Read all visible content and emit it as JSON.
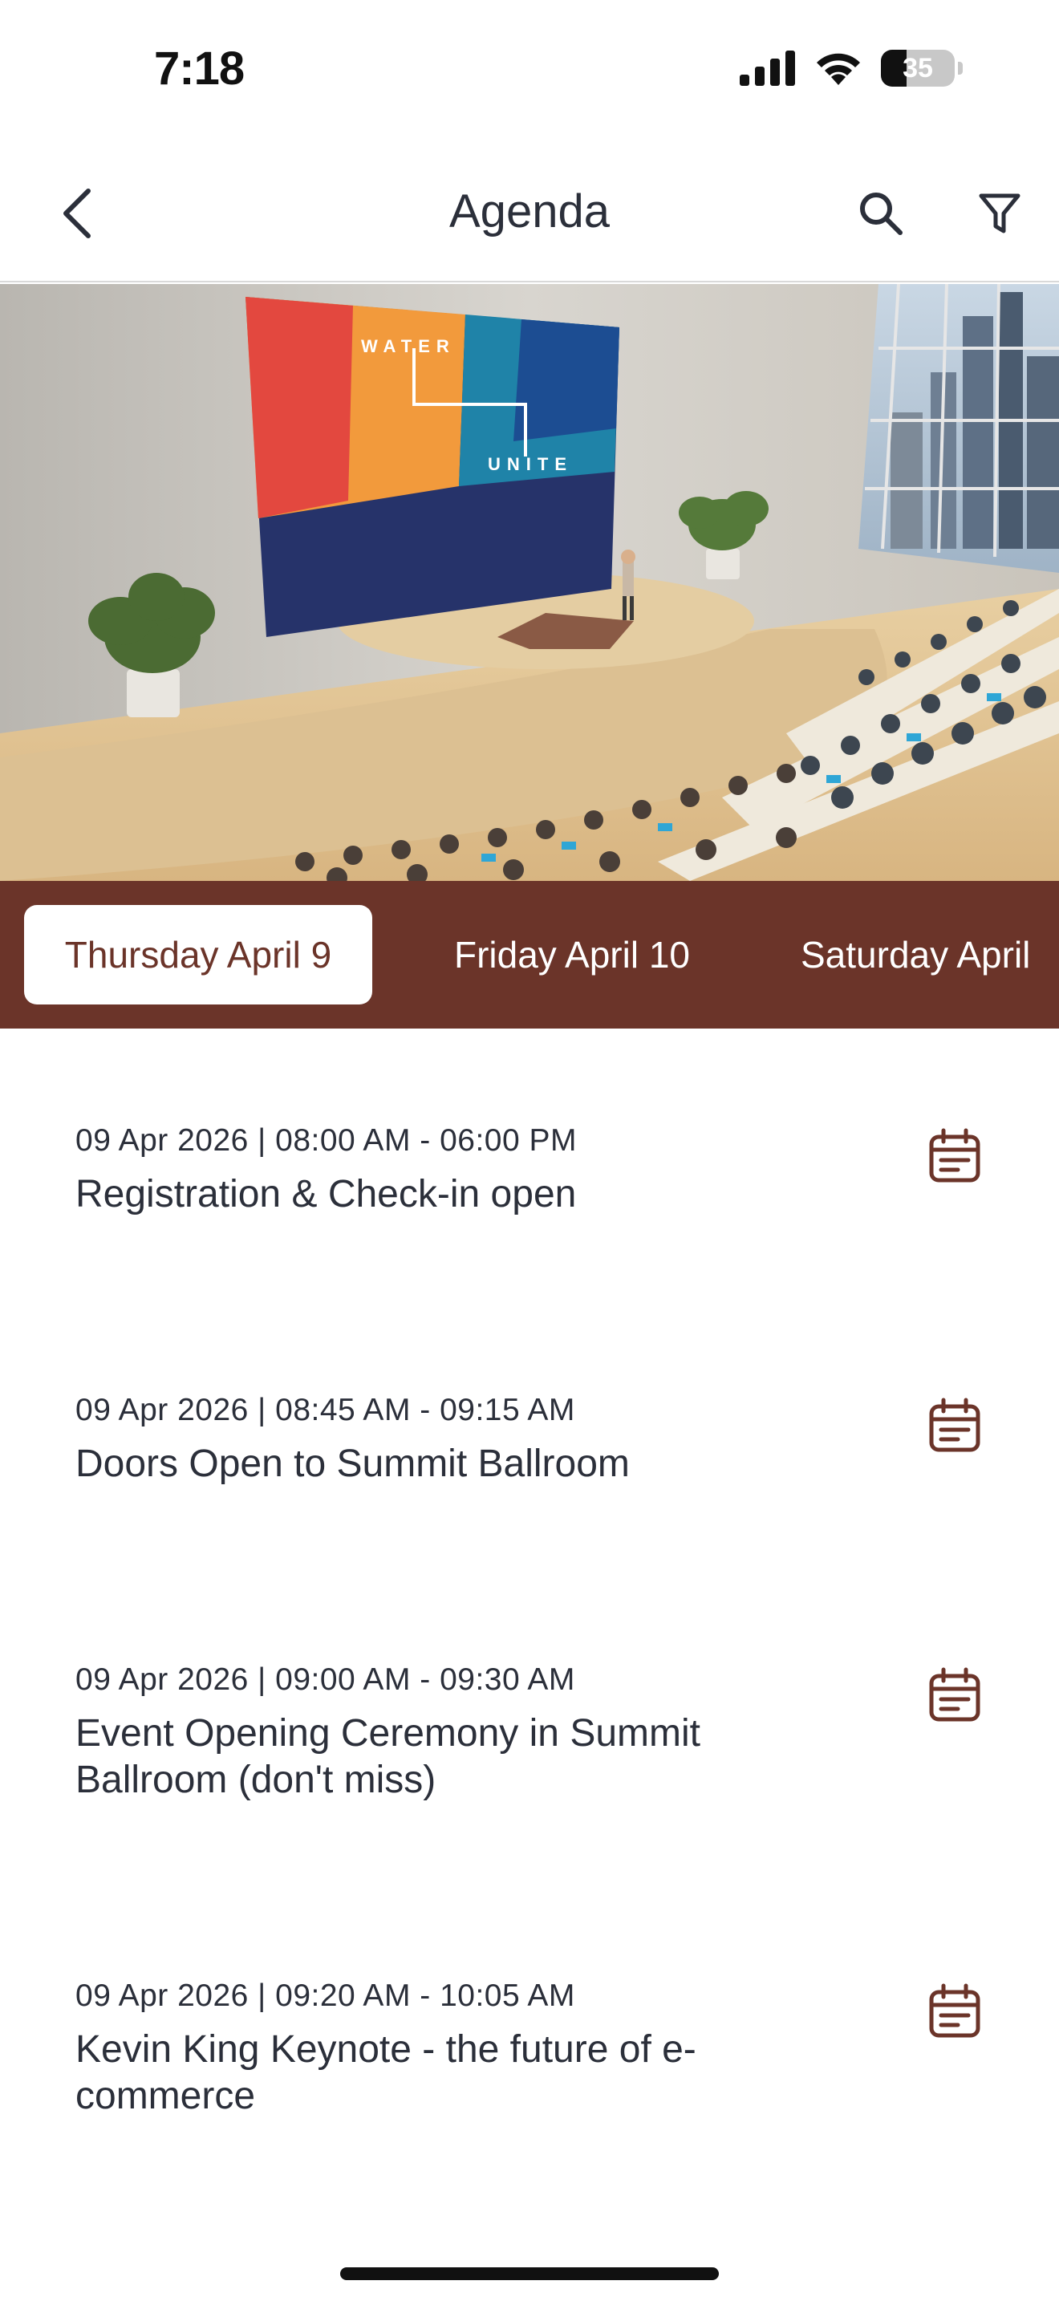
{
  "status_bar": {
    "time": "7:18",
    "battery_level": "35",
    "icons": [
      "cellular-signal-icon",
      "wifi-icon",
      "battery-icon"
    ]
  },
  "header": {
    "title": "Agenda",
    "icons": [
      "chevron-left-icon",
      "search-icon",
      "filter-icon"
    ]
  },
  "banner": {
    "screen_words": [
      "WATER",
      "UNITE"
    ]
  },
  "colors": {
    "accent": "#6b3429",
    "text": "#2b2f3a",
    "tab_active_bg": "#ffffff"
  },
  "day_tabs": [
    {
      "label": "Thursday April 9",
      "selected": true
    },
    {
      "label": "Friday April 10",
      "selected": false
    },
    {
      "label": "Saturday April",
      "selected": false
    }
  ],
  "agenda": [
    {
      "time": "09 Apr 2026 | 08:00 AM - 06:00 PM",
      "title": "Registration & Check-in open"
    },
    {
      "time": "09 Apr 2026 | 08:45 AM - 09:15 AM",
      "title": "Doors Open to Summit Ballroom"
    },
    {
      "time": "09 Apr 2026 | 09:00 AM - 09:30 AM",
      "title": "Event Opening Ceremony in Summit Ballroom (don't miss)"
    },
    {
      "time": "09 Apr 2026 | 09:20 AM - 10:05 AM",
      "title": "Kevin King Keynote - the future of e-commerce"
    }
  ]
}
